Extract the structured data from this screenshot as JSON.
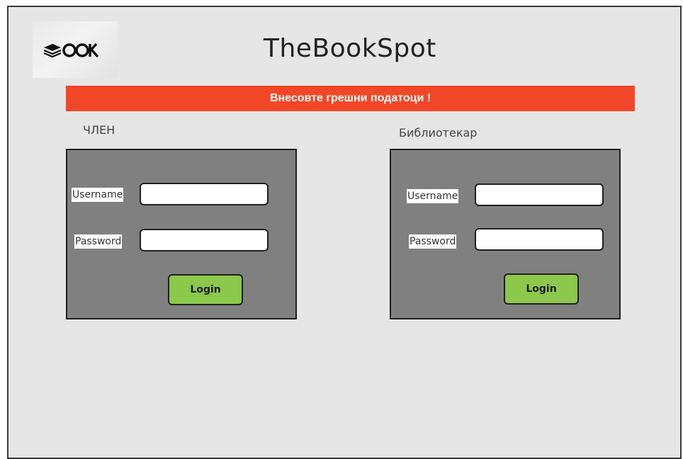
{
  "app": {
    "title": "TheBookSpot",
    "logo_text": "BOOK"
  },
  "error": {
    "message": "Внесовте грешни податоци !"
  },
  "member": {
    "heading": "ЧЛЕН",
    "username_label": "Username",
    "password_label": "Password",
    "username_value": "",
    "password_value": "",
    "login_label": "Login"
  },
  "librarian": {
    "heading": "Библиотекар",
    "username_label": "Username",
    "password_label": "Password",
    "username_value": "",
    "password_value": "",
    "login_label": "Login"
  },
  "colors": {
    "background": "#e6e6e6",
    "error_banner": "#f24727",
    "panel": "#808080",
    "login_button": "#8cc84b"
  }
}
